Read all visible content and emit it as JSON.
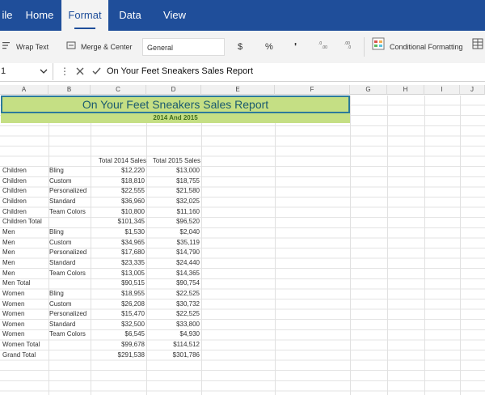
{
  "ribbon": {
    "tabs": [
      {
        "label": "ile"
      },
      {
        "label": "Home"
      },
      {
        "label": "Format"
      },
      {
        "label": "Data"
      },
      {
        "label": "View"
      }
    ]
  },
  "toolbar": {
    "wrap_text": "Wrap Text",
    "merge_center": "Merge & Center",
    "number_format": "General",
    "currency": "$",
    "percent": "%",
    "comma": "'",
    "conditional_formatting": "Conditional Formatting"
  },
  "formula_bar": {
    "name_box": "1",
    "formula": "On Your Feet Sneakers Sales Report"
  },
  "columns": [
    "A",
    "B",
    "C",
    "D",
    "E",
    "F",
    "G",
    "H",
    "I",
    "J"
  ],
  "sheet": {
    "title": "On Your Feet Sneakers Sales Report",
    "subtitle": "2014 And 2015",
    "headers": {
      "c": "Total 2014 Sales",
      "d": "Total 2015 Sales"
    },
    "rows": [
      {
        "a": "Children",
        "b": "Bling",
        "c": "$12,220",
        "d": "$13,000"
      },
      {
        "a": "Children",
        "b": "Custom",
        "c": "$18,810",
        "d": "$18,755"
      },
      {
        "a": "Children",
        "b": "Personalized",
        "c": "$22,555",
        "d": "$21,580"
      },
      {
        "a": "Children",
        "b": "Standard",
        "c": "$36,960",
        "d": "$32,025"
      },
      {
        "a": "Children",
        "b": "Team Colors",
        "c": "$10,800",
        "d": "$11,160"
      },
      {
        "a": "Children Total",
        "b": "",
        "c": "$101,345",
        "d": "$96,520"
      },
      {
        "a": "Men",
        "b": "Bling",
        "c": "$1,530",
        "d": "$2,040"
      },
      {
        "a": "Men",
        "b": "Custom",
        "c": "$34,965",
        "d": "$35,119"
      },
      {
        "a": "Men",
        "b": "Personalized",
        "c": "$17,680",
        "d": "$14,790"
      },
      {
        "a": "Men",
        "b": "Standard",
        "c": "$23,335",
        "d": "$24,440"
      },
      {
        "a": "Men",
        "b": "Team Colors",
        "c": "$13,005",
        "d": "$14,365"
      },
      {
        "a": "Men Total",
        "b": "",
        "c": "$90,515",
        "d": "$90,754"
      },
      {
        "a": "Women",
        "b": "Bling",
        "c": "$18,955",
        "d": "$22,525"
      },
      {
        "a": "Women",
        "b": "Custom",
        "c": "$26,208",
        "d": "$30,732"
      },
      {
        "a": "Women",
        "b": "Personalized",
        "c": "$15,470",
        "d": "$22,525"
      },
      {
        "a": "Women",
        "b": "Standard",
        "c": "$32,500",
        "d": "$33,800"
      },
      {
        "a": "Women",
        "b": "Team Colors",
        "c": "$6,545",
        "d": "$4,930"
      },
      {
        "a": "Women Total",
        "b": "",
        "c": "$99,678",
        "d": "$114,512"
      },
      {
        "a": "Grand Total",
        "b": "",
        "c": "$291,538",
        "d": "$301,786"
      }
    ]
  },
  "colors": {
    "ribbon": "#1f4e9a",
    "title_fill": "#c5df84",
    "selection": "#2c7a9b"
  }
}
